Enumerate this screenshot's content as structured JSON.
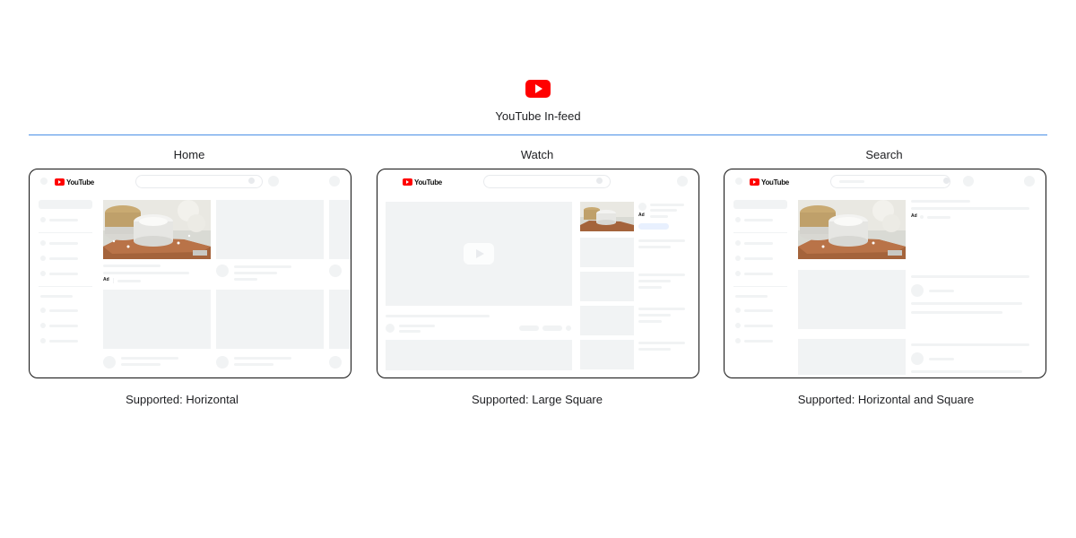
{
  "header": {
    "title": "YouTube In-feed",
    "icon": "youtube-play-icon"
  },
  "panels": [
    {
      "title": "Home",
      "caption": "Supported: Horizontal",
      "ad_label": "Ad",
      "logo_text": "YouTube"
    },
    {
      "title": "Watch",
      "caption": "Supported: Large Square",
      "ad_label": "Ad",
      "logo_text": "YouTube"
    },
    {
      "title": "Search",
      "caption": "Supported: Horizontal and Square",
      "ad_label": "Ad",
      "logo_text": "YouTube"
    }
  ],
  "colors": {
    "accent_line": "#4a8fe7",
    "youtube_red": "#ff0000",
    "placeholder": "#f1f3f4"
  }
}
